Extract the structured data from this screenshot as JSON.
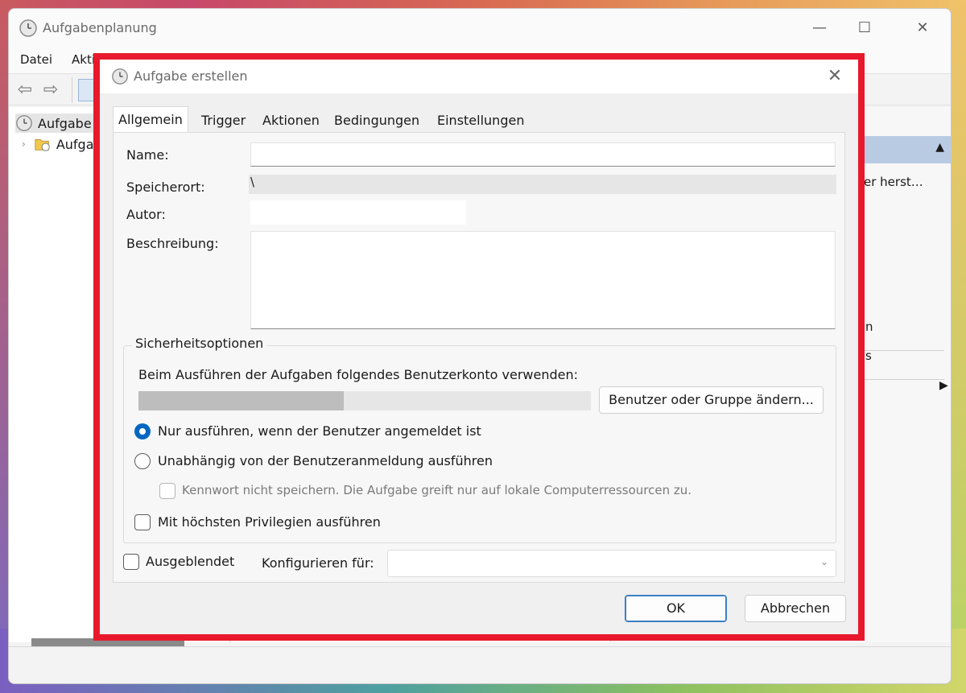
{
  "main_window": {
    "title": "Aufgabenplanung",
    "menu": [
      "Datei",
      "Akti"
    ],
    "tree": [
      "Aufgabe",
      "Aufga"
    ],
    "actions_visible_text": [
      "er herst…",
      "n",
      "s"
    ],
    "controls": {
      "minimize": "—",
      "maximize": "☐",
      "close": "✕"
    }
  },
  "dialog": {
    "title": "Aufgabe erstellen",
    "close": "✕",
    "tabs": [
      "Allgemein",
      "Trigger",
      "Aktionen",
      "Bedingungen",
      "Einstellungen"
    ],
    "active_tab": "Allgemein",
    "fields": {
      "name_label": "Name:",
      "name_value": "",
      "location_label": "Speicherort:",
      "location_value": "\\",
      "author_label": "Autor:",
      "author_value": "",
      "description_label": "Beschreibung:",
      "description_value": ""
    },
    "security": {
      "title": "Sicherheitsoptionen",
      "account_prompt": "Beim Ausführen der Aufgaben folgendes Benutzerkonto verwenden:",
      "change_button": "Benutzer oder Gruppe ändern...",
      "radio_logged_on": "Nur ausführen, wenn der Benutzer angemeldet ist",
      "radio_independent": "Unabhängig von der Benutzeranmeldung ausführen",
      "checkbox_no_password": "Kennwort nicht speichern. Die Aufgabe greift nur auf lokale Computerressourcen zu.",
      "checkbox_highest": "Mit höchsten Privilegien ausführen",
      "selected_radio": "radio_logged_on"
    },
    "hidden_label": "Ausgeblendet",
    "configure_label": "Konfigurieren für:",
    "configure_value": "",
    "ok": "OK",
    "cancel": "Abbrechen"
  },
  "colors": {
    "highlight": "#e8192c",
    "accent": "#0067c0"
  }
}
